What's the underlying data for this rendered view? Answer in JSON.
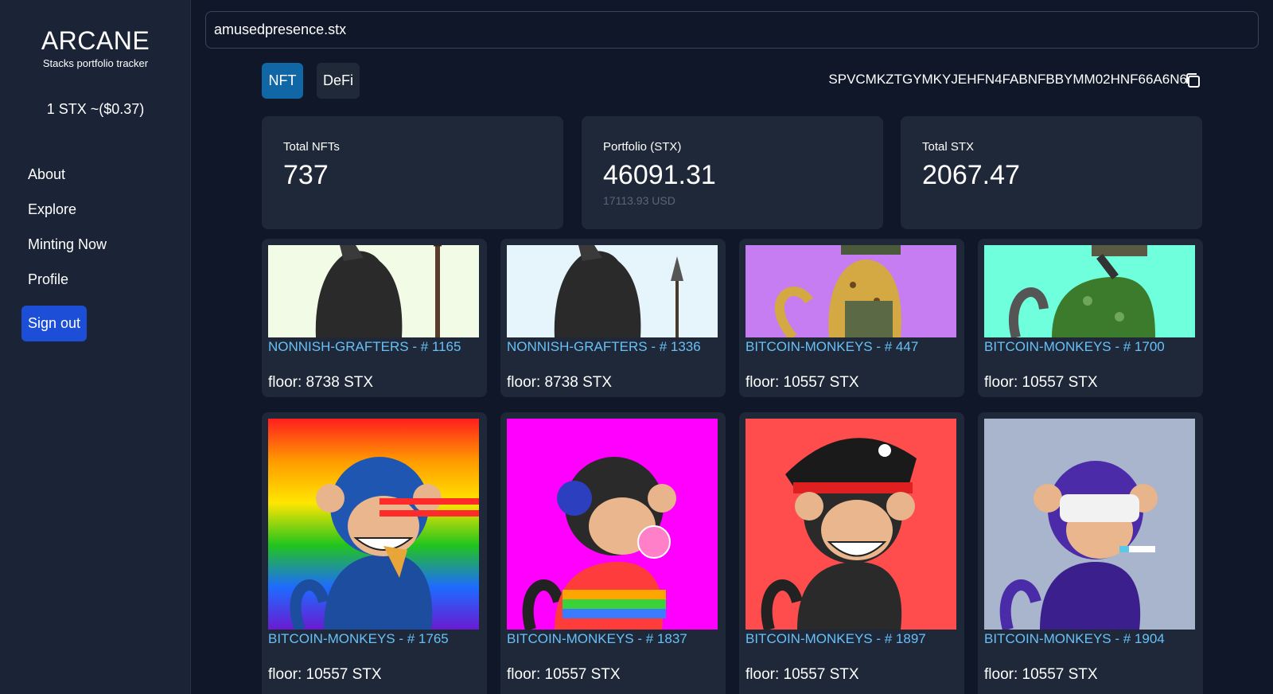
{
  "sidebar": {
    "brand_title": "ARCANE",
    "brand_subtitle": "Stacks portfolio tracker",
    "price": "1 STX ~($0.37)",
    "nav": [
      {
        "label": "About"
      },
      {
        "label": "Explore"
      },
      {
        "label": "Minting Now"
      },
      {
        "label": "Profile"
      }
    ],
    "signout_label": "Sign out"
  },
  "search": {
    "value": "amusedpresence.stx"
  },
  "tabs": [
    {
      "label": "NFT",
      "active": true
    },
    {
      "label": "DeFi",
      "active": false
    }
  ],
  "address": "SPVCMKZTGYMKYJEHFN4FABNFBBYMM02HNF66A6N6",
  "stats": [
    {
      "label": "Total NFTs",
      "value": "737",
      "sub": ""
    },
    {
      "label": "Portfolio (STX)",
      "value": "46091.31",
      "sub": "17113.93 USD"
    },
    {
      "label": "Total STX",
      "value": "2067.47",
      "sub": ""
    }
  ],
  "nfts": [
    {
      "title": "NONNISH-GRAFTERS - # 1165",
      "floor": "floor: 8738 STX",
      "bg": "#f2fbe6"
    },
    {
      "title": "NONNISH-GRAFTERS - # 1336",
      "floor": "floor: 8738 STX",
      "bg": "#e6f5fb"
    },
    {
      "title": "BITCOIN-MONKEYS - # 447",
      "floor": "floor: 10557 STX",
      "bg": "#c77df2"
    },
    {
      "title": "BITCOIN-MONKEYS - # 1700",
      "floor": "floor: 10557 STX",
      "bg": "#6fffdc"
    },
    {
      "title": "BITCOIN-MONKEYS - # 1765",
      "floor": "floor: 10557 STX",
      "bg": "rainbow"
    },
    {
      "title": "BITCOIN-MONKEYS - # 1837",
      "floor": "floor: 10557 STX",
      "bg": "#ff00ff"
    },
    {
      "title": "BITCOIN-MONKEYS - # 1897",
      "floor": "floor: 10557 STX",
      "bg": "#ff4d4d"
    },
    {
      "title": "BITCOIN-MONKEYS - # 1904",
      "floor": "floor: 10557 STX",
      "bg": "#a8b5cc"
    }
  ]
}
